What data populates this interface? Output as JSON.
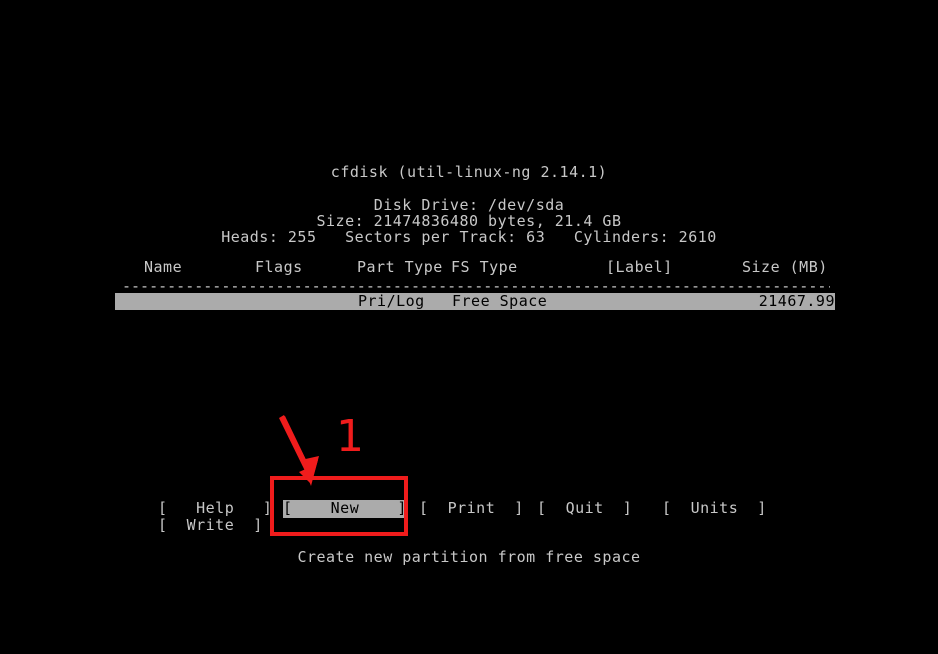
{
  "app": {
    "title": "cfdisk (util-linux-ng 2.14.1)"
  },
  "disk_info": {
    "drive": "Disk Drive: /dev/sda",
    "size": "Size: 21474836480 bytes, 21.4 GB",
    "geometry": "Heads: 255   Sectors per Track: 63   Cylinders: 2610"
  },
  "table": {
    "headers": {
      "name": "Name",
      "flags": "Flags",
      "part_type": "Part Type",
      "fs_type": "FS Type",
      "label": "[Label]",
      "size": "Size (MB)"
    },
    "separator": "--------------------------------------------------------------------------------------",
    "rows": [
      {
        "name": "",
        "flags": "",
        "part_type": "Pri/Log",
        "fs_type": "Free Space",
        "label": "",
        "size": "21467.99",
        "selected": true
      }
    ]
  },
  "menu": {
    "buttons": [
      {
        "label": "[   Help   ]",
        "selected": false
      },
      {
        "label": "[    New    ]",
        "selected": true
      },
      {
        "label": "[  Print  ]",
        "selected": false
      },
      {
        "label": "[  Quit  ]",
        "selected": false
      },
      {
        "label": "[  Units  ]",
        "selected": false
      },
      {
        "label": "[  Write  ]",
        "selected": false
      }
    ],
    "help_label": "[   Help   ]",
    "new_label": "[    New    ]",
    "print_label": "[  Print  ]",
    "quit_label": "[  Quit  ]",
    "units_label": "[  Units  ]",
    "write_label": "[  Write  ]"
  },
  "status": {
    "text": "Create new partition from free space"
  },
  "annotation": {
    "step_number": "1",
    "color": "#f01c1c",
    "target": "new-button"
  },
  "colors": {
    "background": "#000000",
    "foreground": "#c8c8c8",
    "highlight_bg": "#ababab",
    "highlight_fg": "#000000",
    "annotation": "#f01c1c"
  }
}
